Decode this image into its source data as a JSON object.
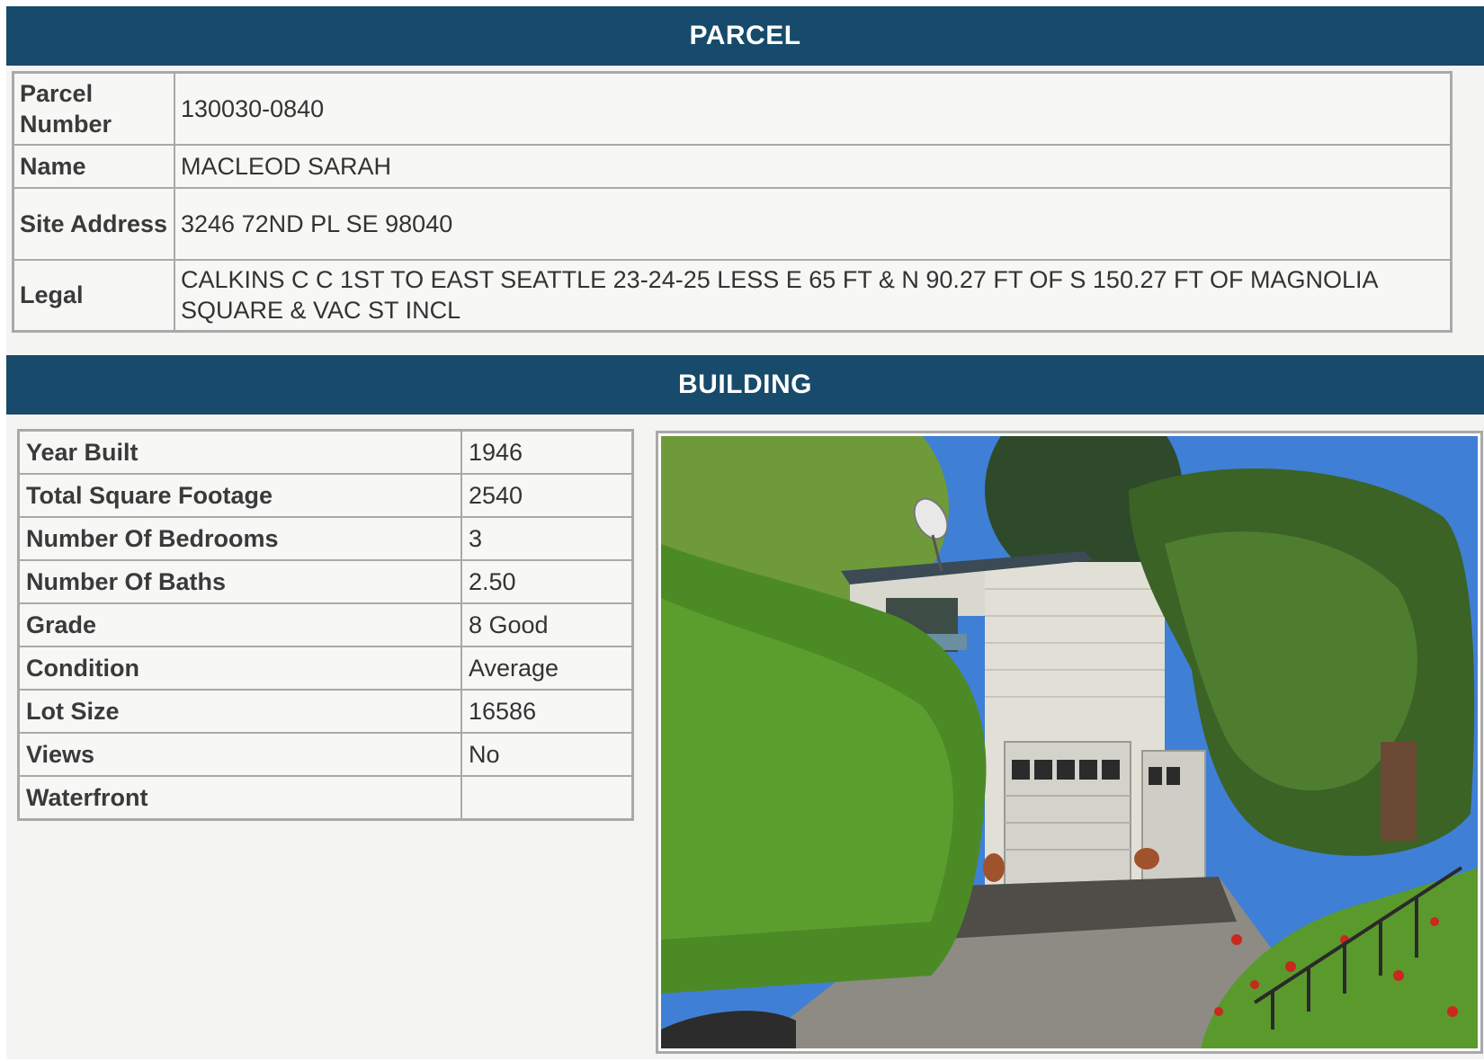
{
  "sections": {
    "parcel_title": "PARCEL",
    "building_title": "BUILDING"
  },
  "parcel": {
    "rows": [
      {
        "label": "Parcel Number",
        "value": "130030-0840"
      },
      {
        "label": "Name",
        "value": "MACLEOD SARAH"
      },
      {
        "label": "Site Address",
        "value": "3246 72ND PL SE 98040"
      },
      {
        "label": "Legal",
        "value": "CALKINS C C 1ST TO EAST SEATTLE 23-24-25 LESS E 65 FT & N 90.27 FT OF S 150.27 FT OF MAGNOLIA SQUARE & VAC ST INCL"
      }
    ]
  },
  "building": {
    "rows": [
      {
        "label": "Year Built",
        "value": "1946"
      },
      {
        "label": "Total Square Footage",
        "value": "2540"
      },
      {
        "label": "Number Of Bedrooms",
        "value": "3"
      },
      {
        "label": "Number Of Baths",
        "value": "2.50"
      },
      {
        "label": "Grade",
        "value": "8 Good"
      },
      {
        "label": "Condition",
        "value": "Average"
      },
      {
        "label": "Lot Size",
        "value": "16586"
      },
      {
        "label": "Views",
        "value": "No"
      },
      {
        "label": "Waterfront",
        "value": ""
      }
    ]
  },
  "colors": {
    "header_band": "#174a6b",
    "header_text": "#ffffff",
    "table_border": "#a9a9a9",
    "panel_background": "#f4f4f2"
  }
}
